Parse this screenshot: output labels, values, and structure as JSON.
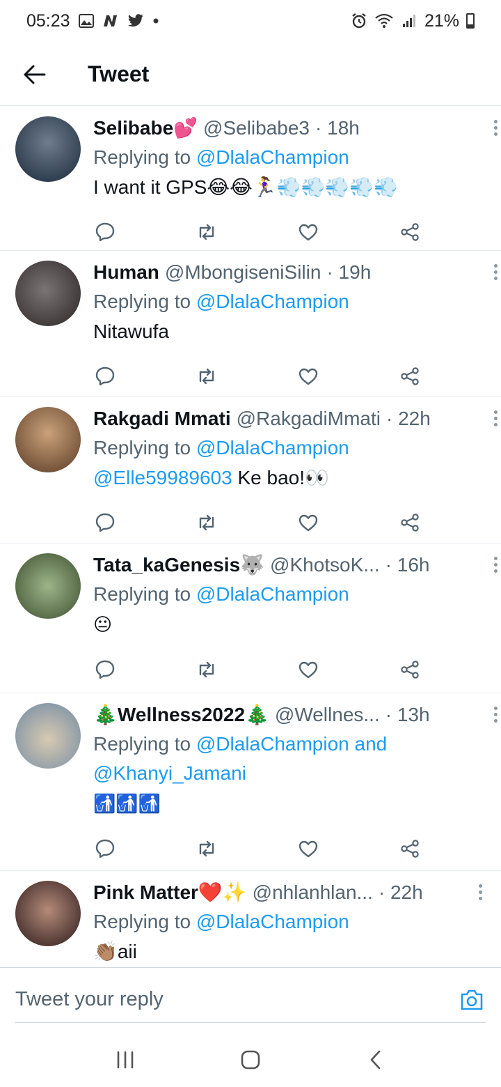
{
  "status_bar": {
    "time": "05:23",
    "battery": "21%",
    "icons": [
      "gallery-icon",
      "n-icon",
      "twitter-icon",
      "dot-icon",
      "alarm-icon",
      "wifi-icon",
      "signal-icon",
      "battery-icon"
    ]
  },
  "header": {
    "title": "Tweet"
  },
  "tweets": [
    {
      "name": "Selibabe💕",
      "handle": "@Selibabe3",
      "time": "· 18h",
      "reply_prefix": "Replying to ",
      "reply_to": "@DlalaChampion",
      "reply_extra": "",
      "text_prefix": "",
      "text": "I want it GPS😂😂🏃‍♀️💨💨💨💨💨",
      "avatar_colors": [
        "#1b2a3a",
        "#6e7c8e"
      ]
    },
    {
      "name": "Human",
      "handle": "@MbongiseniSilin",
      "time": "· 19h",
      "reply_prefix": "Replying to ",
      "reply_to": "@DlalaChampion",
      "reply_extra": "",
      "text_prefix": "",
      "text": "Nitawufa",
      "avatar_colors": [
        "#2a2526",
        "#7b7474"
      ]
    },
    {
      "name": "Rakgadi Mmati",
      "handle": "@RakgadiMmati",
      "time": "· 22h",
      "reply_prefix": "Replying to ",
      "reply_to": "@DlalaChampion",
      "reply_extra": "",
      "text_prefix": "@Elle59989603",
      "text": " Ke bao!👀",
      "avatar_colors": [
        "#5b3a25",
        "#c9a27a"
      ]
    },
    {
      "name": "Tata_kaGenesis🐺",
      "handle": "@KhotsoK...",
      "time": "· 16h",
      "reply_prefix": "Replying to ",
      "reply_to": "@DlalaChampion",
      "reply_extra": "",
      "text_prefix": "",
      "text": "😐",
      "avatar_colors": [
        "#3d4f2f",
        "#9db58a"
      ]
    },
    {
      "name": "🎄Wellness2022🎄",
      "handle": "@Wellnes...",
      "time": "· 13h",
      "reply_prefix": "Replying to ",
      "reply_to": "@DlalaChampion and",
      "reply_extra": "@Khanyi_Jamani",
      "text_prefix": "",
      "text": "🚮🚮🚮",
      "avatar_colors": [
        "#6f8aa3",
        "#d8c9b2"
      ]
    },
    {
      "name": "Pink Matter❤️✨",
      "handle": "@nhlanhlan...",
      "time": "· 22h",
      "reply_prefix": "Replying to ",
      "reply_to": "@DlalaChampion",
      "reply_extra": "",
      "text_prefix": "",
      "text": "👏🏽aii",
      "avatar_colors": [
        "#2a1a1a",
        "#b58a7a"
      ]
    }
  ],
  "reply_bar": {
    "placeholder": "Tweet your reply"
  },
  "nav": {
    "icons": [
      "recent-apps-icon",
      "home-icon",
      "back-icon"
    ]
  },
  "colors": {
    "link": "#1d9bf0",
    "secondary": "#536471",
    "text": "#0f1419"
  }
}
